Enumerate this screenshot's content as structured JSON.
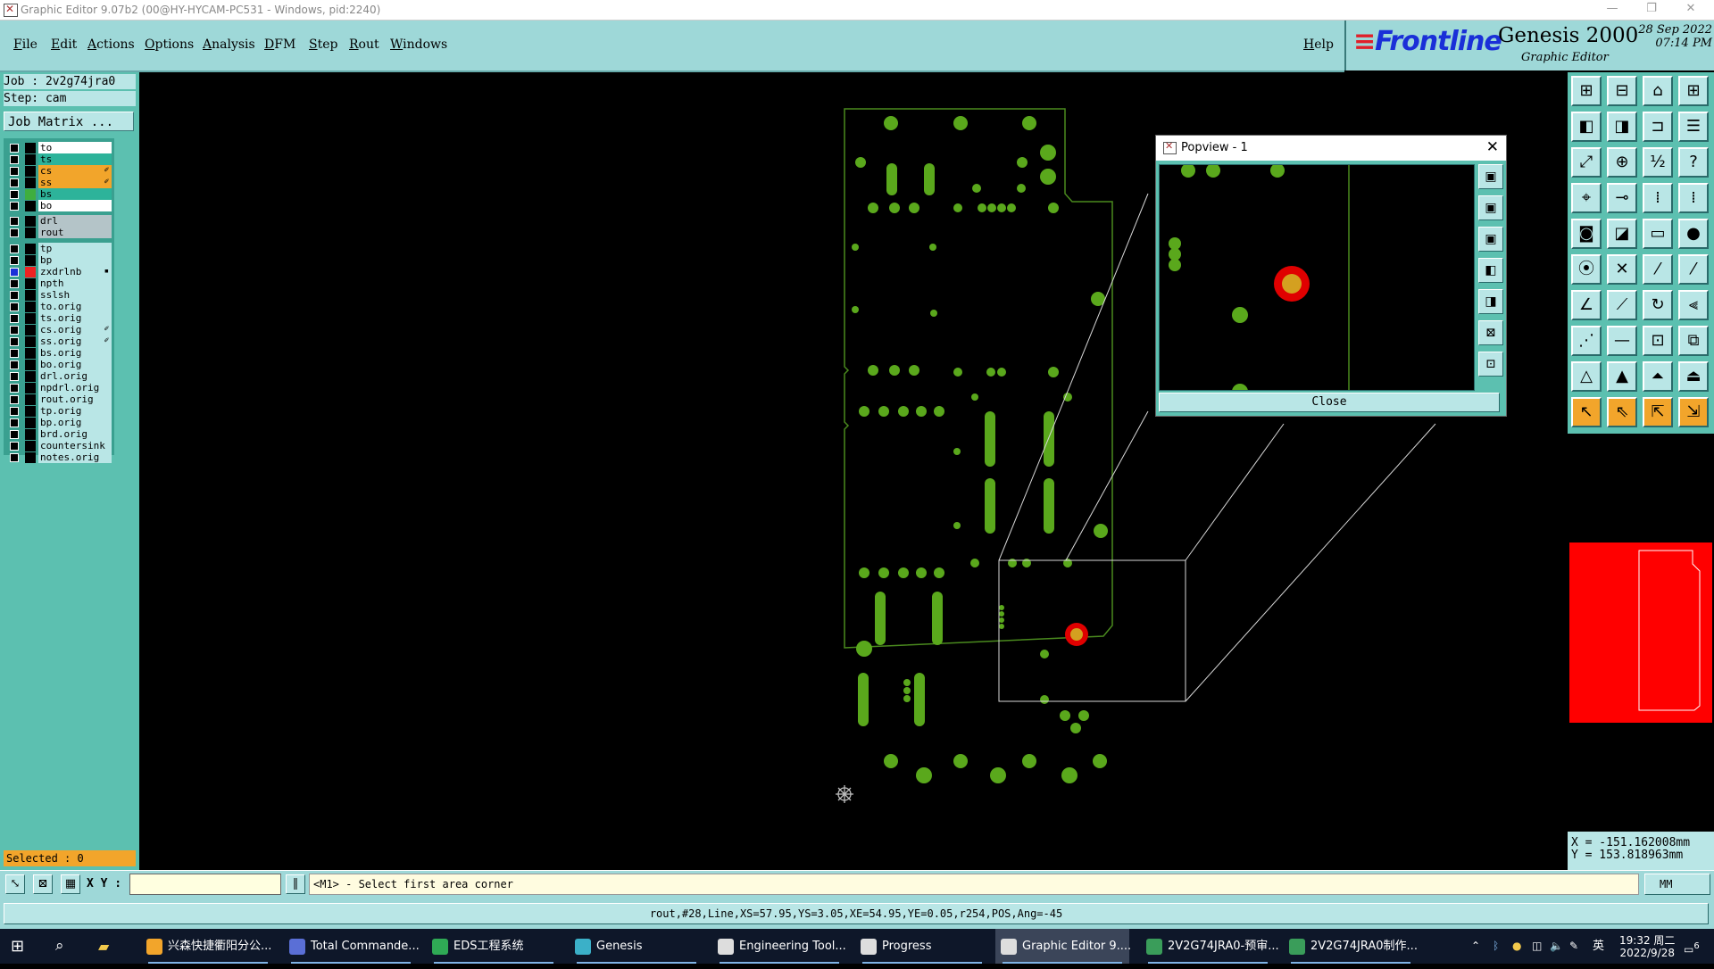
{
  "window": {
    "title": "Graphic Editor 9.07b2 (00@HY-HYCAM-PC531 - Windows, pid:2240)",
    "controls": {
      "minimize": "—",
      "restore": "❐",
      "close": "✕"
    }
  },
  "menu": [
    "File",
    "Edit",
    "Actions",
    "Options",
    "Analysis",
    "DFM",
    "Step",
    "Rout",
    "Windows"
  ],
  "help_label": "Help",
  "brand": {
    "logo": "Frontline",
    "product": "Genesis 2000",
    "subtitle": "Graphic Editor",
    "date": "28 Sep 2022",
    "time": "07:14 PM"
  },
  "job": {
    "job": "Job : 2v2g74jra0",
    "step": "Step: cam",
    "job_matrix": "Job Matrix ..."
  },
  "layers": [
    {
      "name": "to",
      "color": "#ffffff"
    },
    {
      "name": "ts",
      "color": "#2db39a"
    },
    {
      "name": "cs",
      "color": "#f2a52b",
      "edit": "✐"
    },
    {
      "name": "ss",
      "color": "#f2a52b",
      "edit": "✐"
    },
    {
      "name": "bs",
      "color": "#2db39a",
      "swatch": "#3fae3f"
    },
    {
      "name": "bo",
      "color": "#ffffff"
    },
    {
      "name": "drl",
      "color": "#b4c4c8"
    },
    {
      "name": "rout",
      "color": "#b4c4c8"
    },
    {
      "name": "tp",
      "color": "#b9e6e6"
    },
    {
      "name": "bp",
      "color": "#b9e6e6"
    },
    {
      "name": "zxdrlnb",
      "color": "#b9e6e6",
      "swatch": "#e22",
      "checked": true,
      "edit": "▪"
    },
    {
      "name": "npth",
      "color": "#b9e6e6"
    },
    {
      "name": "sslsh",
      "color": "#b9e6e6"
    },
    {
      "name": "to.orig",
      "color": "#b9e6e6"
    },
    {
      "name": "ts.orig",
      "color": "#b9e6e6"
    },
    {
      "name": "cs.orig",
      "color": "#b9e6e6",
      "edit": "✐"
    },
    {
      "name": "ss.orig",
      "color": "#b9e6e6",
      "edit": "✐"
    },
    {
      "name": "bs.orig",
      "color": "#b9e6e6"
    },
    {
      "name": "bo.orig",
      "color": "#b9e6e6"
    },
    {
      "name": "drl.orig",
      "color": "#b9e6e6"
    },
    {
      "name": "npdrl.orig",
      "color": "#b9e6e6"
    },
    {
      "name": "rout.orig",
      "color": "#b9e6e6"
    },
    {
      "name": "tp.orig",
      "color": "#b9e6e6"
    },
    {
      "name": "bp.orig",
      "color": "#b9e6e6"
    },
    {
      "name": "brd.orig",
      "color": "#b9e6e6"
    },
    {
      "name": "countersink",
      "color": "#b9e6e6"
    },
    {
      "name": "notes.orig",
      "color": "#b9e6e6"
    }
  ],
  "selected": "Selected : 0",
  "popview": {
    "title": "Popview - 1",
    "close_label": "Close",
    "close_x": "✕"
  },
  "coords": {
    "x": "X = -151.162008mm",
    "y": "Y = 153.818963mm"
  },
  "command": {
    "xy_label": "X Y :",
    "xy_value": "",
    "prompt": "<M1> - Select first area corner",
    "unit": "MM"
  },
  "info": "rout,#28,Line,XS=57.95,YS=3.05,XE=54.95,YE=0.05,r254,POS,Ang=-45",
  "taskbar": {
    "items": [
      {
        "label": "兴森快捷衢阳分公...",
        "icon_color": "#f2a52b"
      },
      {
        "label": "Total Commande...",
        "icon_color": "#5a6fd6"
      },
      {
        "label": "EDS工程系统",
        "icon_color": "#2faa55"
      },
      {
        "label": "Genesis",
        "icon_color": "#3bb0c8"
      },
      {
        "label": "Engineering Tool...",
        "icon_color": "#dddddd"
      },
      {
        "label": "Progress",
        "icon_color": "#dddddd"
      },
      {
        "label": "Graphic Editor 9....",
        "icon_color": "#dddddd"
      },
      {
        "label": "2V2G74JRA0-预审...",
        "icon_color": "#3a9d5a"
      },
      {
        "label": "2V2G74JRA0制作...",
        "icon_color": "#3a9d5a"
      }
    ],
    "clock_time": "19:32 周二",
    "clock_date": "2022/9/28",
    "ime": "英",
    "notif": "6"
  }
}
